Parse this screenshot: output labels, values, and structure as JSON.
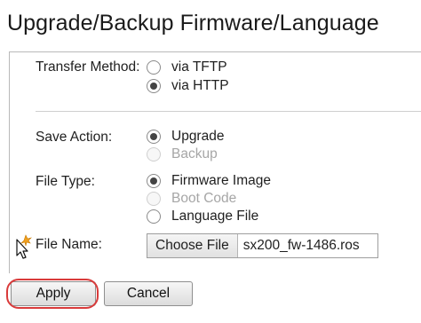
{
  "page": {
    "title": "Upgrade/Backup Firmware/Language"
  },
  "transfer_method": {
    "label": "Transfer Method:",
    "options": [
      {
        "label": "via TFTP",
        "selected": false,
        "disabled": false
      },
      {
        "label": "via HTTP",
        "selected": true,
        "disabled": false
      }
    ]
  },
  "save_action": {
    "label": "Save Action:",
    "options": [
      {
        "label": "Upgrade",
        "selected": true,
        "disabled": false
      },
      {
        "label": "Backup",
        "selected": false,
        "disabled": true
      }
    ]
  },
  "file_type": {
    "label": "File Type:",
    "options": [
      {
        "label": "Firmware Image",
        "selected": true,
        "disabled": false
      },
      {
        "label": "Boot Code",
        "selected": false,
        "disabled": true
      },
      {
        "label": "Language File",
        "selected": false,
        "disabled": false
      }
    ]
  },
  "file_name": {
    "label": "File Name:",
    "choose_button": "Choose File",
    "value": "sx200_fw-1486.ros"
  },
  "actions": {
    "apply": "Apply",
    "cancel": "Cancel"
  },
  "colors": {
    "highlight": "#d93b3b",
    "divider": "#cfcfcf",
    "disabled_text": "#a6a6a6"
  }
}
